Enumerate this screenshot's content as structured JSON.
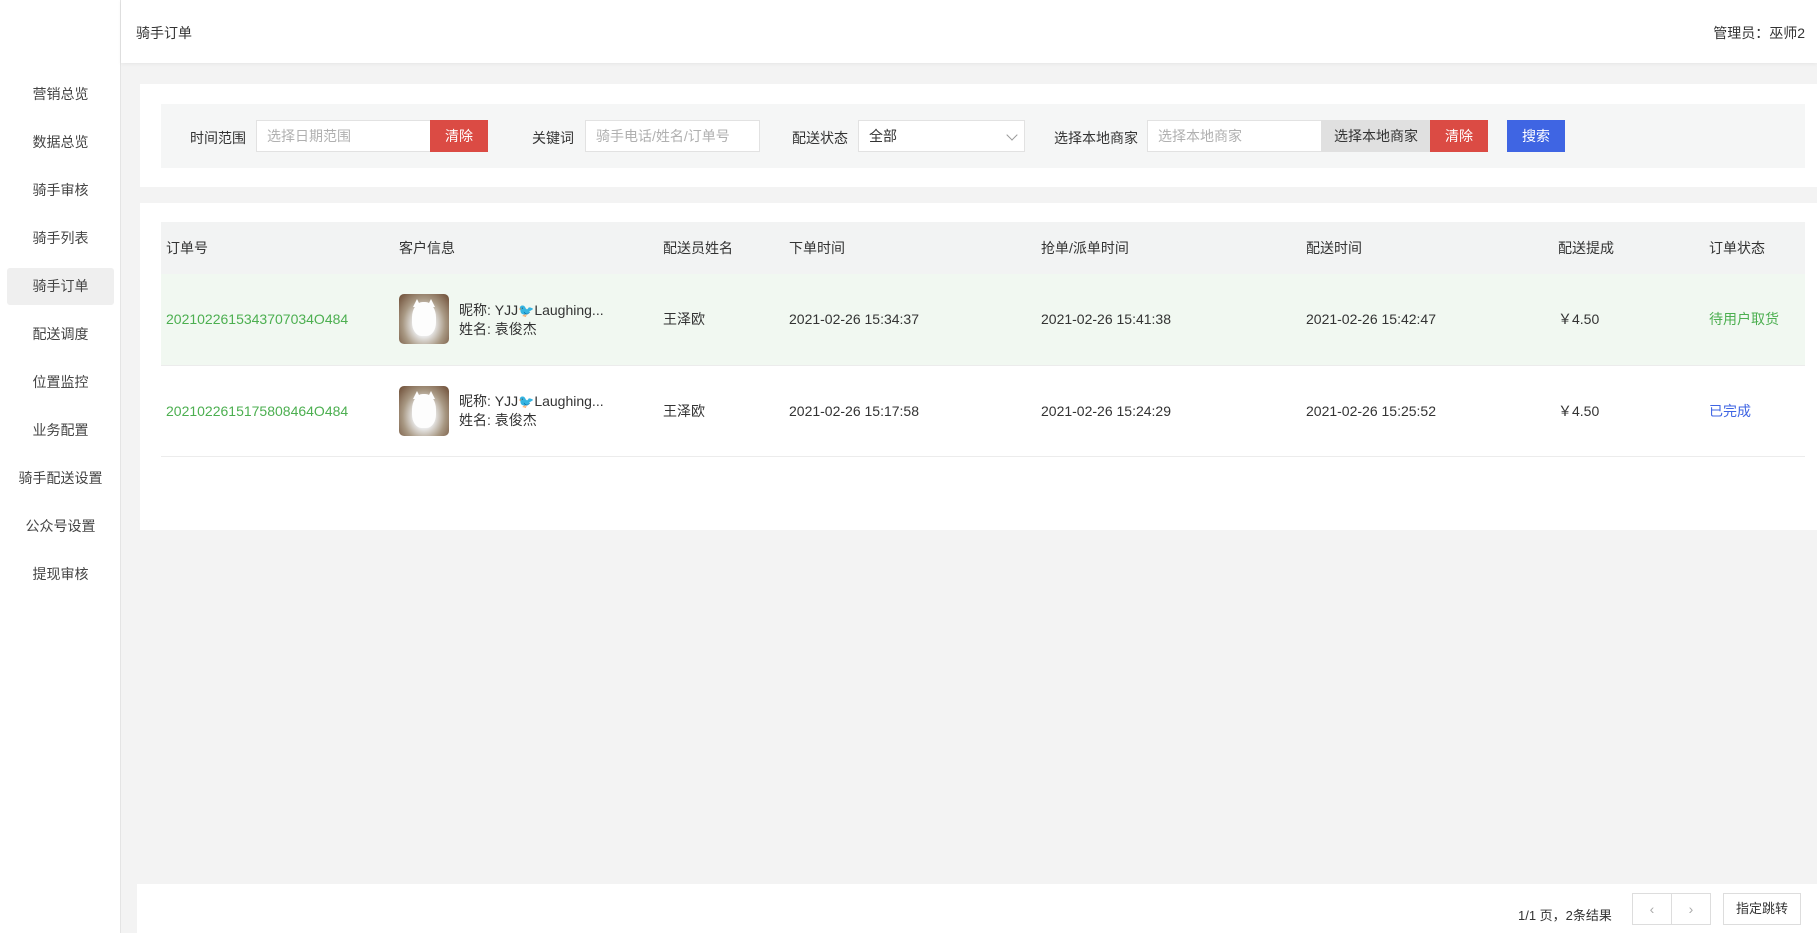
{
  "sidebar": {
    "items": [
      {
        "label": "营销总览"
      },
      {
        "label": "数据总览"
      },
      {
        "label": "骑手审核"
      },
      {
        "label": "骑手列表"
      },
      {
        "label": "骑手订单"
      },
      {
        "label": "配送调度"
      },
      {
        "label": "位置监控"
      },
      {
        "label": "业务配置"
      },
      {
        "label": "骑手配送设置"
      },
      {
        "label": "公众号设置"
      },
      {
        "label": "提现审核"
      }
    ],
    "active": "骑手订单"
  },
  "header": {
    "title": "骑手订单",
    "admin": "管理员：巫师2"
  },
  "filters": {
    "time_label": "时间范围",
    "time_placeholder": "选择日期范围",
    "time_clear": "清除",
    "keyword_label": "关键词",
    "keyword_placeholder": "骑手电话/姓名/订单号",
    "status_label": "配送状态",
    "status_value": "全部",
    "merchant_label": "选择本地商家",
    "merchant_placeholder": "选择本地商家",
    "merchant_select": "选择本地商家",
    "merchant_clear": "清除",
    "search": "搜索"
  },
  "table": {
    "columns": [
      "订单号",
      "客户信息",
      "配送员姓名",
      "下单时间",
      "抢单/派单时间",
      "配送时间",
      "配送提成",
      "订单状态"
    ],
    "rows": [
      {
        "order_no": "2021022615343707034O484",
        "nickname": "昵称: YJJ",
        "nickname_suffix": "Laughing...",
        "name": "姓名: 袁俊杰",
        "courier": "王泽欧",
        "order_time": "2021-02-26 15:34:37",
        "grab_time": "2021-02-26 15:41:38",
        "delivery_time": "2021-02-26 15:42:47",
        "commission": "￥4.50",
        "status": "待用户取货"
      },
      {
        "order_no": "2021022615175808464O484",
        "nickname": "昵称: YJJ",
        "nickname_suffix": "Laughing...",
        "name": "姓名: 袁俊杰",
        "courier": "王泽欧",
        "order_time": "2021-02-26 15:17:58",
        "grab_time": "2021-02-26 15:24:29",
        "delivery_time": "2021-02-26 15:25:52",
        "commission": "￥4.50",
        "status": "已完成"
      }
    ]
  },
  "pagination": {
    "info": "1/1 页，2条结果",
    "prev": "‹",
    "next": "›",
    "jump": "指定跳转"
  },
  "colors": {
    "accent_red": "#db4b44",
    "accent_blue": "#3f65e3",
    "status_green": "#4caf50"
  }
}
